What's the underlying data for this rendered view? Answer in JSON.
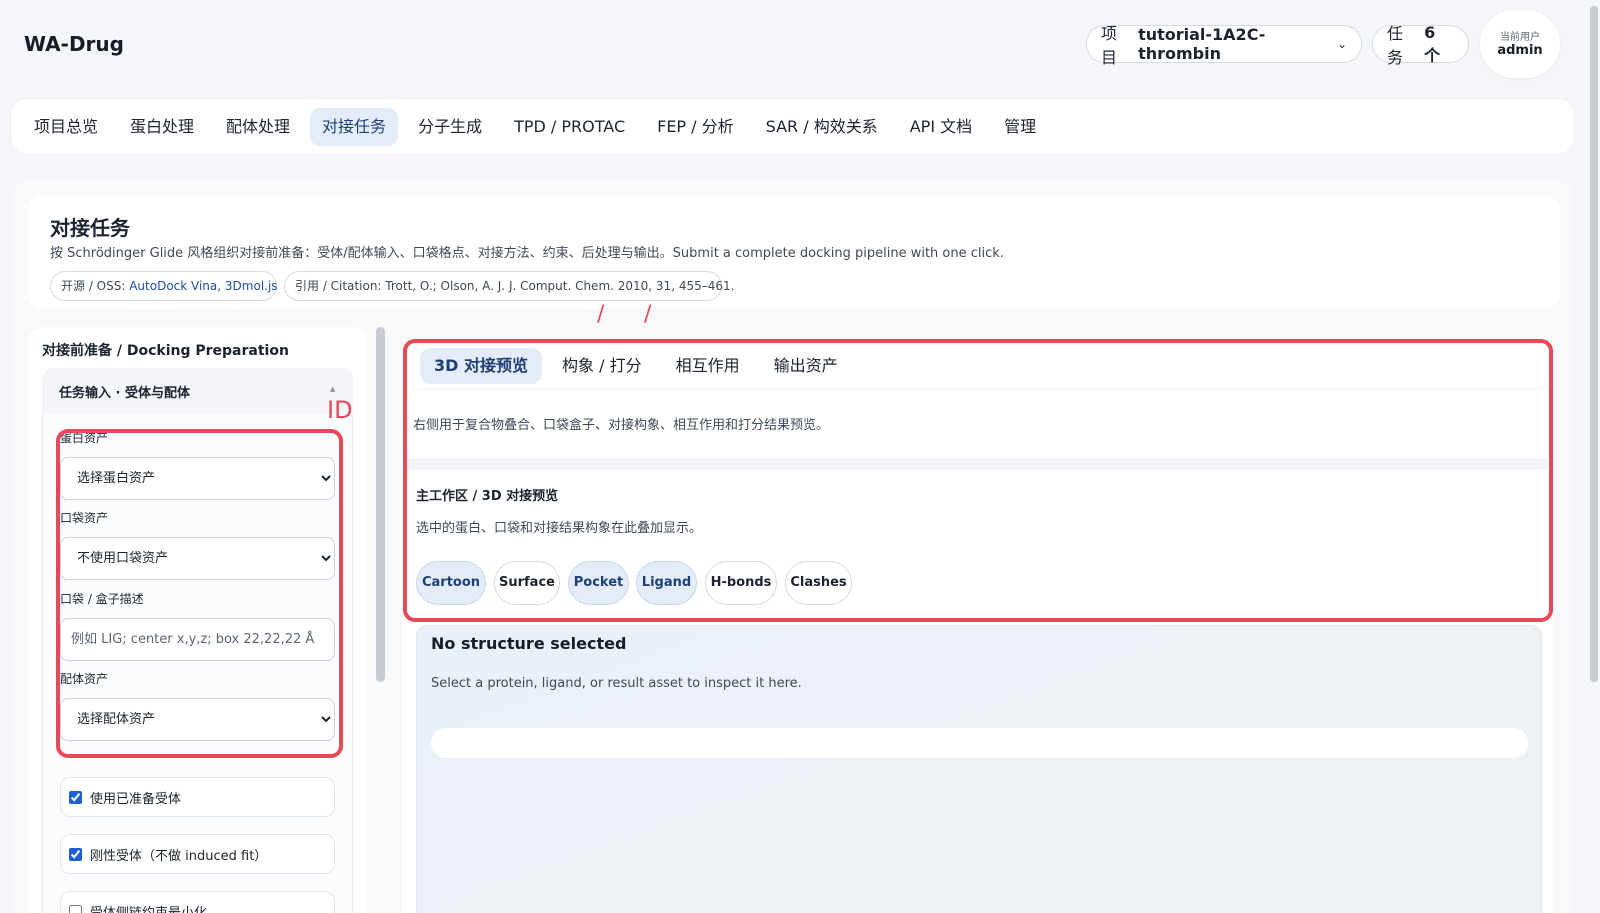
{
  "brand": "WA-Drug",
  "header": {
    "project_label": "项目",
    "project_value": "tutorial-1A2C-thrombin",
    "task_label": "任务",
    "task_value": "6 个",
    "user_label": "当前用户",
    "user_name": "admin"
  },
  "nav": {
    "items": [
      "项目总览",
      "蛋白处理",
      "配体处理",
      "对接任务",
      "分子生成",
      "TPD / PROTAC",
      "FEP / 分析",
      "SAR / 构效关系",
      "API 文档",
      "管理"
    ],
    "active_index": 3
  },
  "page": {
    "title": "对接任务",
    "description": "按 Schrödinger Glide 风格组织对接前准备：受体/配体输入、口袋格点、对接方法、约束、后处理与输出。Submit a complete docking pipeline with one click.",
    "oss_prefix": "开源 / OSS: ",
    "oss_links": [
      "AutoDock Vina",
      "3Dmol.js"
    ],
    "oss_separator": ", ",
    "citation": "引用 / Citation: Trott, O.; Olson, A. J. J. Comput. Chem. 2010, 31, 455–461."
  },
  "annotations": {
    "slash_mark": "/",
    "id_mark": "ID"
  },
  "left": {
    "section_title": "对接前准备 / Docking Preparation",
    "accordion_title": "任务输入 · 受体与配体",
    "accordion_caret": "▲",
    "protein_label": "蛋白资产",
    "protein_selected": "选择蛋白资产",
    "pocket_label": "口袋资产",
    "pocket_selected": "不使用口袋资产",
    "box_label": "口袋 / 盒子描述",
    "box_placeholder": "例如 LIG; center x,y,z; box 22,22,22 Å",
    "ligand_label": "配体资产",
    "ligand_selected": "选择配体资产",
    "checkboxes": [
      {
        "label": "使用已准备受体",
        "checked": true
      },
      {
        "label": "刚性受体（不做 induced fit）",
        "checked": true
      },
      {
        "label": "受体侧链约束最小化",
        "checked": false
      }
    ]
  },
  "right": {
    "tabs": [
      "3D 对接预览",
      "构象 / 打分",
      "相互作用",
      "输出资产"
    ],
    "active_tab": 0,
    "description": "右侧用于复合物叠合、口袋盒子、对接构象、相互作用和打分结果预览。",
    "workspace_title": "主工作区 / 3D 对接预览",
    "workspace_desc": "选中的蛋白、口袋和对接结果构象在此叠加显示。",
    "chips": [
      {
        "label": "Cartoon",
        "on": true
      },
      {
        "label": "Surface",
        "on": false
      },
      {
        "label": "Pocket",
        "on": true
      },
      {
        "label": "Ligand",
        "on": true
      },
      {
        "label": "H-bonds",
        "on": false
      },
      {
        "label": "Clashes",
        "on": false
      }
    ],
    "viewer_title": "No structure selected",
    "viewer_sub": "Select a protein, ligand, or result asset to inspect it here."
  },
  "colors": {
    "accent": "#1d3f73",
    "active_bg": "#e3ecf8",
    "annotation_red": "#e44a5a",
    "link": "#1f4fa3"
  }
}
